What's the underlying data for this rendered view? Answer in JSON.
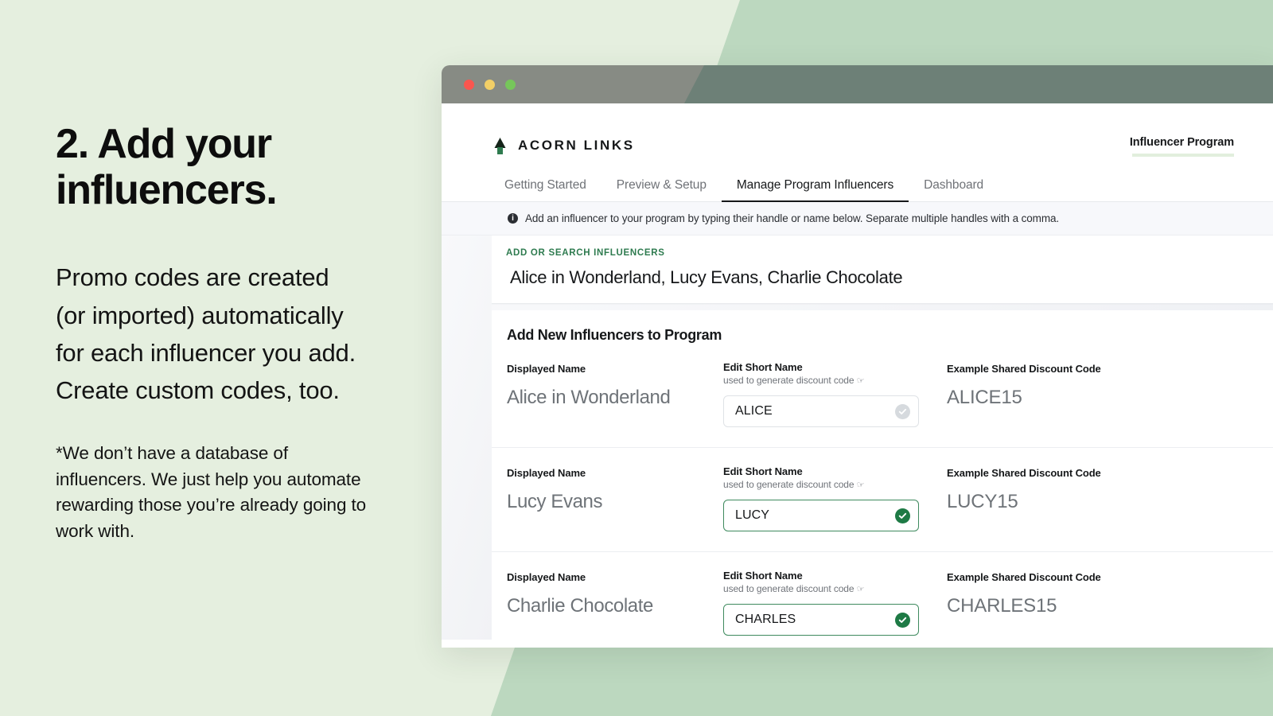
{
  "slide": {
    "headline": "2. Add your\ninfluencers.",
    "body": "Promo codes are created\n(or imported) automatically\nfor each influencer you add.\nCreate custom codes, too.",
    "footnote": "*We don’t have a database of\ninfluencers. We just help you automate\nrewarding those you’re already going to\nwork with.",
    "background_color": "#e5efdf",
    "accent_band_color": "#bcd8bf"
  },
  "window": {
    "titlebar_color": "#878b84",
    "titlebar_shade_color": "#6d8077",
    "traffic_lights": [
      {
        "name": "close",
        "color": "#f9564f"
      },
      {
        "name": "minimize",
        "color": "#f2cf66"
      },
      {
        "name": "maximize",
        "color": "#76c65a"
      }
    ]
  },
  "app": {
    "brand": {
      "icon": "pine-tree-icon",
      "name": "ACORN LINKS"
    },
    "program_tag": "Influencer Program",
    "tabs": [
      {
        "label": "Getting Started",
        "active": false
      },
      {
        "label": "Preview & Setup",
        "active": false
      },
      {
        "label": "Manage Program Influencers",
        "active": true
      },
      {
        "label": "Dashboard",
        "active": false
      }
    ],
    "info_banner": {
      "icon": "info-icon",
      "icon_glyph": "i",
      "text": "Add an influencer to your program by typing their handle or name below. Separate multiple handles with a comma."
    },
    "search": {
      "label": "ADD OR SEARCH INFLUENCERS",
      "label_color": "#2e7b4f",
      "value": "Alice in Wonderland, Lucy Evans, Charlie Chocolate",
      "placeholder": "Add or search influencers"
    },
    "card": {
      "title": "Add New Influencers to Program",
      "columns": {
        "displayed_name": "Displayed Name",
        "short_name": "Edit Short Name",
        "short_name_sub": "used to generate discount code",
        "short_name_sub_glyph": "☞",
        "discount_code": "Example Shared Discount Code"
      },
      "rows": [
        {
          "displayed_name": "Alice in Wonderland",
          "short_name": "ALICE",
          "discount_code": "ALICE15",
          "state": "inactive",
          "check_icon": "check-circle-icon"
        },
        {
          "displayed_name": "Lucy Evans",
          "short_name": "LUCY",
          "discount_code": "LUCY15",
          "state": "valid",
          "check_icon": "check-circle-icon"
        },
        {
          "displayed_name": "Charlie Chocolate",
          "short_name": "CHARLES",
          "discount_code": "CHARLES15",
          "state": "valid",
          "check_icon": "check-circle-icon"
        }
      ]
    },
    "colors": {
      "valid_green": "#1e7a45",
      "border_green": "#3e8a5e",
      "inactive_grey": "#d6dade",
      "text_dark": "#16181a",
      "text_muted": "#6e7378"
    }
  }
}
